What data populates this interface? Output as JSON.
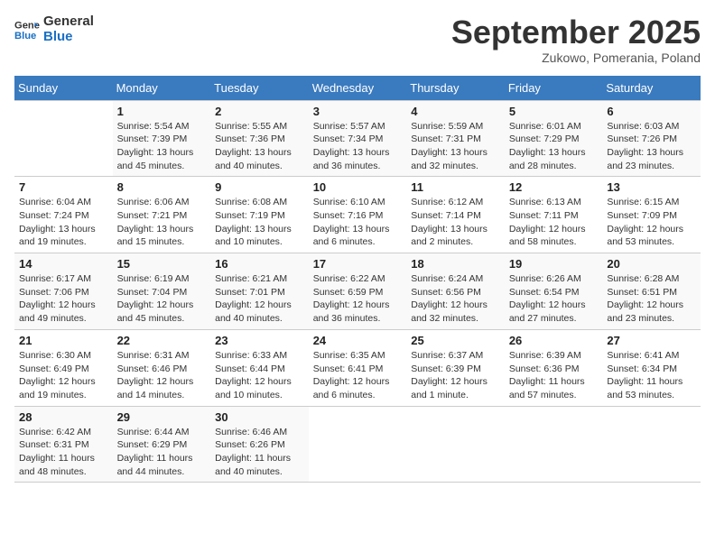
{
  "logo": {
    "line1": "General",
    "line2": "Blue"
  },
  "title": "September 2025",
  "subtitle": "Zukowo, Pomerania, Poland",
  "days_of_week": [
    "Sunday",
    "Monday",
    "Tuesday",
    "Wednesday",
    "Thursday",
    "Friday",
    "Saturday"
  ],
  "weeks": [
    [
      {
        "day": "",
        "info": ""
      },
      {
        "day": "1",
        "info": "Sunrise: 5:54 AM\nSunset: 7:39 PM\nDaylight: 13 hours\nand 45 minutes."
      },
      {
        "day": "2",
        "info": "Sunrise: 5:55 AM\nSunset: 7:36 PM\nDaylight: 13 hours\nand 40 minutes."
      },
      {
        "day": "3",
        "info": "Sunrise: 5:57 AM\nSunset: 7:34 PM\nDaylight: 13 hours\nand 36 minutes."
      },
      {
        "day": "4",
        "info": "Sunrise: 5:59 AM\nSunset: 7:31 PM\nDaylight: 13 hours\nand 32 minutes."
      },
      {
        "day": "5",
        "info": "Sunrise: 6:01 AM\nSunset: 7:29 PM\nDaylight: 13 hours\nand 28 minutes."
      },
      {
        "day": "6",
        "info": "Sunrise: 6:03 AM\nSunset: 7:26 PM\nDaylight: 13 hours\nand 23 minutes."
      }
    ],
    [
      {
        "day": "7",
        "info": "Sunrise: 6:04 AM\nSunset: 7:24 PM\nDaylight: 13 hours\nand 19 minutes."
      },
      {
        "day": "8",
        "info": "Sunrise: 6:06 AM\nSunset: 7:21 PM\nDaylight: 13 hours\nand 15 minutes."
      },
      {
        "day": "9",
        "info": "Sunrise: 6:08 AM\nSunset: 7:19 PM\nDaylight: 13 hours\nand 10 minutes."
      },
      {
        "day": "10",
        "info": "Sunrise: 6:10 AM\nSunset: 7:16 PM\nDaylight: 13 hours\nand 6 minutes."
      },
      {
        "day": "11",
        "info": "Sunrise: 6:12 AM\nSunset: 7:14 PM\nDaylight: 13 hours\nand 2 minutes."
      },
      {
        "day": "12",
        "info": "Sunrise: 6:13 AM\nSunset: 7:11 PM\nDaylight: 12 hours\nand 58 minutes."
      },
      {
        "day": "13",
        "info": "Sunrise: 6:15 AM\nSunset: 7:09 PM\nDaylight: 12 hours\nand 53 minutes."
      }
    ],
    [
      {
        "day": "14",
        "info": "Sunrise: 6:17 AM\nSunset: 7:06 PM\nDaylight: 12 hours\nand 49 minutes."
      },
      {
        "day": "15",
        "info": "Sunrise: 6:19 AM\nSunset: 7:04 PM\nDaylight: 12 hours\nand 45 minutes."
      },
      {
        "day": "16",
        "info": "Sunrise: 6:21 AM\nSunset: 7:01 PM\nDaylight: 12 hours\nand 40 minutes."
      },
      {
        "day": "17",
        "info": "Sunrise: 6:22 AM\nSunset: 6:59 PM\nDaylight: 12 hours\nand 36 minutes."
      },
      {
        "day": "18",
        "info": "Sunrise: 6:24 AM\nSunset: 6:56 PM\nDaylight: 12 hours\nand 32 minutes."
      },
      {
        "day": "19",
        "info": "Sunrise: 6:26 AM\nSunset: 6:54 PM\nDaylight: 12 hours\nand 27 minutes."
      },
      {
        "day": "20",
        "info": "Sunrise: 6:28 AM\nSunset: 6:51 PM\nDaylight: 12 hours\nand 23 minutes."
      }
    ],
    [
      {
        "day": "21",
        "info": "Sunrise: 6:30 AM\nSunset: 6:49 PM\nDaylight: 12 hours\nand 19 minutes."
      },
      {
        "day": "22",
        "info": "Sunrise: 6:31 AM\nSunset: 6:46 PM\nDaylight: 12 hours\nand 14 minutes."
      },
      {
        "day": "23",
        "info": "Sunrise: 6:33 AM\nSunset: 6:44 PM\nDaylight: 12 hours\nand 10 minutes."
      },
      {
        "day": "24",
        "info": "Sunrise: 6:35 AM\nSunset: 6:41 PM\nDaylight: 12 hours\nand 6 minutes."
      },
      {
        "day": "25",
        "info": "Sunrise: 6:37 AM\nSunset: 6:39 PM\nDaylight: 12 hours\nand 1 minute."
      },
      {
        "day": "26",
        "info": "Sunrise: 6:39 AM\nSunset: 6:36 PM\nDaylight: 11 hours\nand 57 minutes."
      },
      {
        "day": "27",
        "info": "Sunrise: 6:41 AM\nSunset: 6:34 PM\nDaylight: 11 hours\nand 53 minutes."
      }
    ],
    [
      {
        "day": "28",
        "info": "Sunrise: 6:42 AM\nSunset: 6:31 PM\nDaylight: 11 hours\nand 48 minutes."
      },
      {
        "day": "29",
        "info": "Sunrise: 6:44 AM\nSunset: 6:29 PM\nDaylight: 11 hours\nand 44 minutes."
      },
      {
        "day": "30",
        "info": "Sunrise: 6:46 AM\nSunset: 6:26 PM\nDaylight: 11 hours\nand 40 minutes."
      },
      {
        "day": "",
        "info": ""
      },
      {
        "day": "",
        "info": ""
      },
      {
        "day": "",
        "info": ""
      },
      {
        "day": "",
        "info": ""
      }
    ]
  ]
}
